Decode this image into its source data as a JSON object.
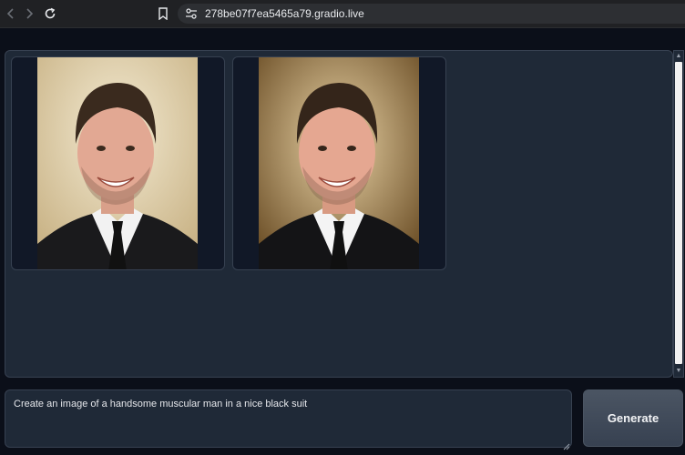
{
  "browser": {
    "url": "278be07f7ea5465a79.gradio.live",
    "icons": [
      "back-icon",
      "forward-icon",
      "reload-icon",
      "bookmark-icon",
      "site-settings-icon"
    ]
  },
  "gallery": {
    "images": [
      {
        "description": "portrait",
        "background_color": "#d9c7a0"
      },
      {
        "description": "portrait",
        "background_color": "#8a6a3b"
      }
    ]
  },
  "prompt": {
    "value": "Create an image of a handsome muscular man in a nice black suit"
  },
  "generate": {
    "label": "Generate"
  }
}
